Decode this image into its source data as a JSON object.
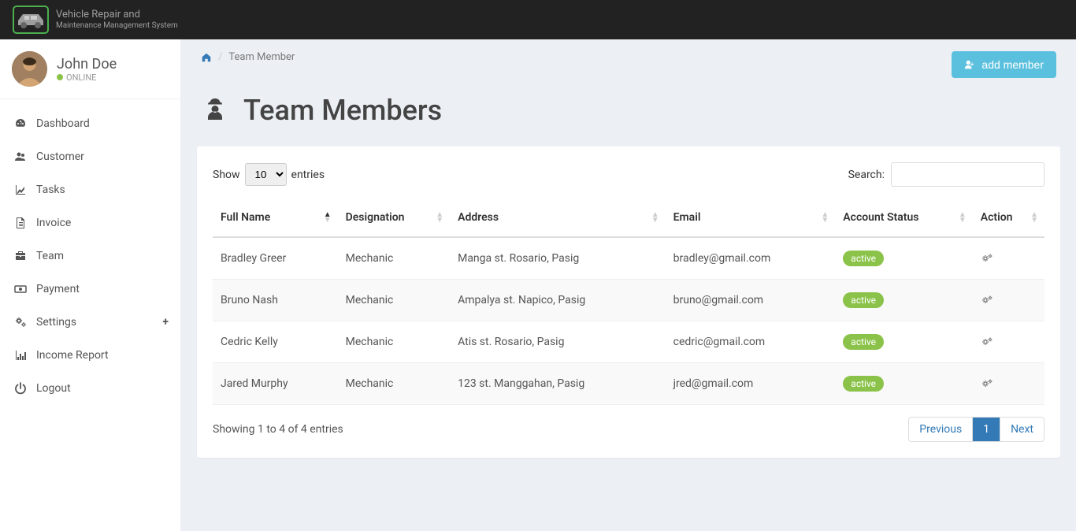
{
  "app": {
    "name_line1": "Vehicle Repair and",
    "name_line2": "Maintenance Management System"
  },
  "user": {
    "name": "John Doe",
    "status": "ONLINE"
  },
  "sidebar": {
    "items": [
      {
        "label": "Dashboard",
        "icon": "tachometer"
      },
      {
        "label": "Customer",
        "icon": "users"
      },
      {
        "label": "Tasks",
        "icon": "chart-line"
      },
      {
        "label": "Invoice",
        "icon": "file"
      },
      {
        "label": "Team",
        "icon": "toolbox"
      },
      {
        "label": "Payment",
        "icon": "money"
      },
      {
        "label": "Settings",
        "icon": "cogs",
        "expandable": true
      },
      {
        "label": "Income Report",
        "icon": "bar-chart"
      },
      {
        "label": "Logout",
        "icon": "power"
      }
    ]
  },
  "breadcrumb": {
    "current": "Team Member"
  },
  "header": {
    "add_button": "add member",
    "title": "Team Members"
  },
  "table": {
    "show_label": "Show",
    "entries_label": "entries",
    "entries_value": "10",
    "search_label": "Search:",
    "columns": [
      "Full Name",
      "Designation",
      "Address",
      "Email",
      "Account Status",
      "Action"
    ],
    "rows": [
      {
        "name": "Bradley Greer",
        "designation": "Mechanic",
        "address": "Manga st. Rosario, Pasig",
        "email": "bradley@gmail.com",
        "status": "active"
      },
      {
        "name": "Bruno Nash",
        "designation": "Mechanic",
        "address": "Ampalya st. Napico, Pasig",
        "email": "bruno@gmail.com",
        "status": "active"
      },
      {
        "name": "Cedric Kelly",
        "designation": "Mechanic",
        "address": "Atis st. Rosario, Pasig",
        "email": "cedric@gmail.com",
        "status": "active"
      },
      {
        "name": "Jared Murphy",
        "designation": "Mechanic",
        "address": "123 st. Manggahan, Pasig",
        "email": "jred@gmail.com",
        "status": "active"
      }
    ],
    "info": "Showing 1 to 4 of 4 entries",
    "pagination": {
      "previous": "Previous",
      "next": "Next",
      "current": "1"
    }
  }
}
